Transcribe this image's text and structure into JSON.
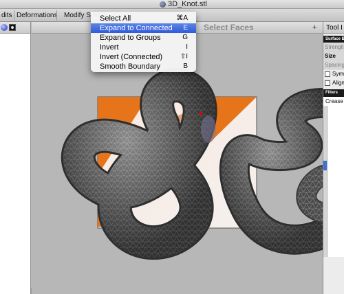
{
  "window": {
    "title": "3D_Knot.stl",
    "icon": "document-sphere-icon"
  },
  "toolbar": {
    "items": [
      "dits",
      "Deformations",
      "Modify Sele"
    ]
  },
  "left_panel": {
    "icons": [
      "sphere-icon",
      "checker-square-icon"
    ]
  },
  "viewport": {
    "header_title": "Select Faces",
    "header_plus": "+"
  },
  "menu": {
    "items": [
      {
        "label": "Select All",
        "shortcut": "⌘A"
      },
      {
        "label": "Expand to Connected",
        "shortcut": "E"
      },
      {
        "label": "Expand to Groups",
        "shortcut": "G"
      },
      {
        "label": "Invert",
        "shortcut": "I"
      },
      {
        "label": "Invert (Connected)",
        "shortcut": "⇧I"
      },
      {
        "label": "Smooth Boundary",
        "shortcut": "B"
      }
    ],
    "highlighted_index": 1
  },
  "right_panel": {
    "tab_label": "Tool I",
    "section_header": "Surface B",
    "rows": [
      "Strengtl",
      "Size",
      "Spacing"
    ],
    "checks": [
      "Symm",
      "Align"
    ],
    "filters_header": "Filters",
    "crease_label": "Crease A"
  },
  "colors": {
    "highlight": "#2f5bd9",
    "selection_orange": "#e5741a",
    "mesh_dark": "#4a4a4a",
    "viewport_bg": "#b7b7b7"
  }
}
